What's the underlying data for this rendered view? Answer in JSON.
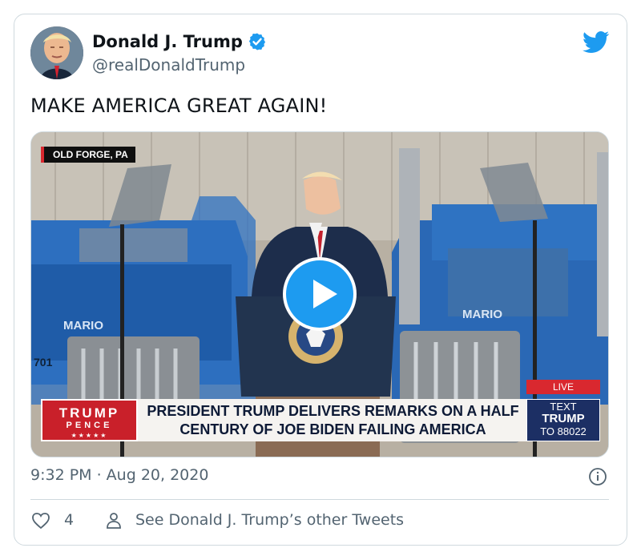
{
  "tweet": {
    "author_name": "Donald J. Trump",
    "author_handle": "@realDonaldTrump",
    "text": "MAKE AMERICA GREAT AGAIN!",
    "timestamp": "9:32 PM · Aug 20, 2020",
    "like_count": "4",
    "see_other_tweets": "See Donald J. Trump’s other Tweets"
  },
  "video": {
    "location": "OLD FORGE, PA",
    "brand_top": "TRUMP",
    "brand_mid": "PENCE",
    "brand_stars": "★★★★★",
    "headline_line1": "PRESIDENT TRUMP DELIVERS REMARKS ON A HALF",
    "headline_line2": "CENTURY OF JOE BIDEN FAILING AMERICA",
    "live_label": "LIVE",
    "text_line1": "TEXT",
    "text_line2": "TRUMP",
    "text_line3": "TO 88022",
    "truck_text_left": "MARIO",
    "truck_text_right": "MARIO",
    "truck_number": "701"
  },
  "colors": {
    "twitter_blue": "#1d9bf0",
    "secondary_text": "#536471",
    "border": "#cfd9de",
    "chyron_red": "#c9202a",
    "chyron_navy": "#1c2f64"
  },
  "icons": {
    "verified": "verified-badge-icon",
    "twitter": "twitter-bird-icon",
    "info": "info-icon",
    "like": "heart-icon",
    "person": "person-icon",
    "play": "play-icon"
  }
}
